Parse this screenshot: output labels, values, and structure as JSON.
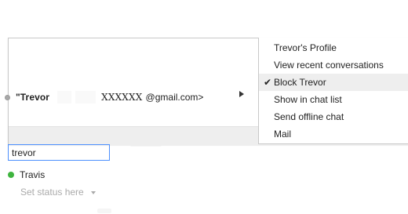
{
  "contact": {
    "name": "\"Trevor",
    "masked_email": "XXXXXX",
    "email_domain": "@gmail.com>"
  },
  "menu": {
    "items": [
      {
        "label": "Trevor's Profile",
        "checked": false,
        "active": false
      },
      {
        "label": "View recent conversations",
        "checked": false,
        "active": false
      },
      {
        "label": "Block Trevor",
        "checked": true,
        "active": true
      },
      {
        "label": "Show in chat list",
        "checked": false,
        "active": false
      },
      {
        "label": "Send offline chat",
        "checked": false,
        "active": false
      },
      {
        "label": "Mail",
        "checked": false,
        "active": false
      }
    ],
    "check_glyph": "✔"
  },
  "search": {
    "value": "trevor"
  },
  "contacts_list": {
    "first_contact": "Travis"
  },
  "status": {
    "text": "Set status here"
  },
  "colors": {
    "focus_border": "#4d90fe",
    "online_green": "#3fb43f",
    "menu_highlight": "#eeeeee"
  }
}
